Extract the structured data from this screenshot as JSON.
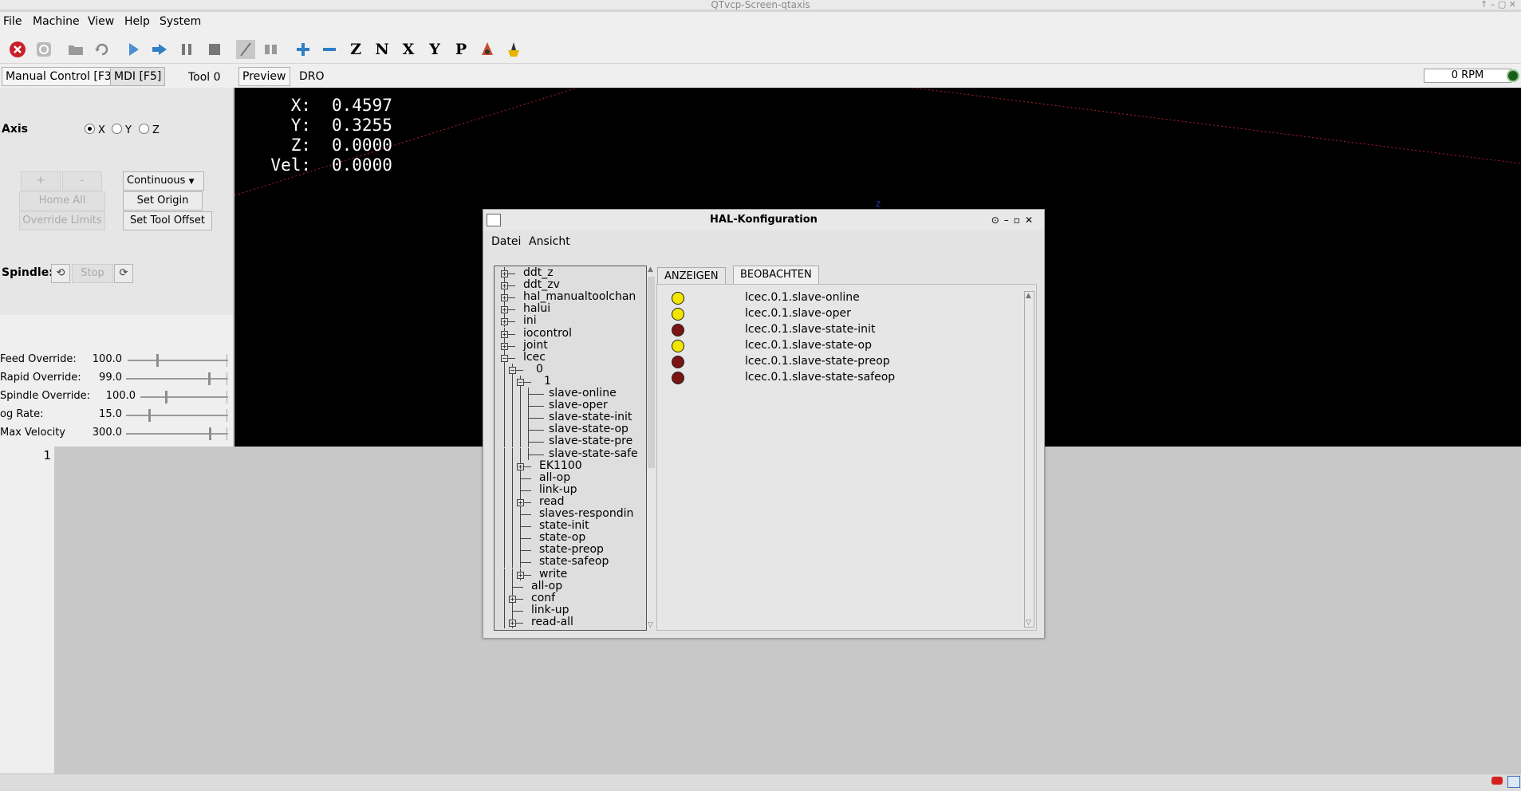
{
  "window_title": "QTvcp-Screen-qtaxis",
  "menu": [
    "File",
    "Machine",
    "View",
    "Help",
    "System"
  ],
  "tabs": {
    "manual": "Manual Control [F3]",
    "mdi": "MDI [F5]",
    "tool": "Tool 0",
    "preview": "Preview",
    "dro": "DRO"
  },
  "rpm": "0 RPM",
  "axis": {
    "label": "Axis",
    "options": [
      "X",
      "Y",
      "Z"
    ],
    "selected": "X"
  },
  "jog": {
    "plus": "+",
    "minus": "-",
    "home_all": "Home All",
    "override_limits": "Override Limits",
    "mode": "Continuous",
    "set_origin": "Set Origin",
    "set_tool_offset": "Set Tool Offset"
  },
  "spindle": {
    "label": "Spindle:",
    "stop": "Stop"
  },
  "overrides": [
    {
      "label": "Feed Override:",
      "value": "100.0",
      "fraction": 0.29
    },
    {
      "label": "Rapid Override:",
      "value": "99.0",
      "fraction": 0.82
    },
    {
      "label": "Spindle Override:",
      "value": "100.0",
      "fraction": 0.29
    },
    {
      "label": "og Rate:",
      "value": "15.0",
      "fraction": 0.22
    },
    {
      "label": "Max Velocity",
      "value": "300.0",
      "fraction": 0.83
    }
  ],
  "dro": [
    {
      "axis": "X:",
      "value": "0.4597"
    },
    {
      "axis": "Y:",
      "value": "0.3255"
    },
    {
      "axis": "Z:",
      "value": "0.0000"
    },
    {
      "axis": "Vel:",
      "value": "0.0000"
    }
  ],
  "editor": {
    "line_no": "1"
  },
  "hal": {
    "title": "HAL-Konfiguration",
    "menu": [
      "Datei",
      "Ansicht"
    ],
    "tabs": [
      "ANZEIGEN",
      "BEOBACHTEN"
    ],
    "tree": [
      {
        "label": "ddt_z",
        "level": 0,
        "exp": true
      },
      {
        "label": "ddt_zv",
        "level": 0,
        "exp": true
      },
      {
        "label": "hal_manualtoolchan",
        "level": 0,
        "exp": true
      },
      {
        "label": "halui",
        "level": 0,
        "exp": true
      },
      {
        "label": "ini",
        "level": 0,
        "exp": true
      },
      {
        "label": "iocontrol",
        "level": 0,
        "exp": true
      },
      {
        "label": "joint",
        "level": 0,
        "exp": true
      },
      {
        "label": "lcec",
        "level": 0,
        "exp": true
      },
      {
        "label": "0",
        "level": 1,
        "exp": true
      },
      {
        "label": "1",
        "level": 2,
        "exp": true
      },
      {
        "label": "slave-online",
        "level": 3,
        "exp": false
      },
      {
        "label": "slave-oper",
        "level": 3,
        "exp": false
      },
      {
        "label": "slave-state-init",
        "level": 3,
        "exp": false
      },
      {
        "label": "slave-state-op",
        "level": 3,
        "exp": false
      },
      {
        "label": "slave-state-pre",
        "level": 3,
        "exp": false
      },
      {
        "label": "slave-state-safe",
        "level": 3,
        "exp": false
      },
      {
        "label": "EK1100",
        "level": 2,
        "exp": true
      },
      {
        "label": "all-op",
        "level": 2,
        "exp": false
      },
      {
        "label": "link-up",
        "level": 2,
        "exp": false
      },
      {
        "label": "read",
        "level": 2,
        "exp": true
      },
      {
        "label": "slaves-respondin",
        "level": 2,
        "exp": false
      },
      {
        "label": "state-init",
        "level": 2,
        "exp": false
      },
      {
        "label": "state-op",
        "level": 2,
        "exp": false
      },
      {
        "label": "state-preop",
        "level": 2,
        "exp": false
      },
      {
        "label": "state-safeop",
        "level": 2,
        "exp": false
      },
      {
        "label": "write",
        "level": 2,
        "exp": true
      },
      {
        "label": "all-op",
        "level": 1,
        "exp": false
      },
      {
        "label": "conf",
        "level": 1,
        "exp": true
      },
      {
        "label": "link-up",
        "level": 1,
        "exp": false
      },
      {
        "label": "read-all",
        "level": 1,
        "exp": true
      }
    ],
    "watch": [
      {
        "name": "lcec.0.1.slave-online",
        "state": "on"
      },
      {
        "name": "lcec.0.1.slave-oper",
        "state": "on"
      },
      {
        "name": "lcec.0.1.slave-state-init",
        "state": "off"
      },
      {
        "name": "lcec.0.1.slave-state-op",
        "state": "on"
      },
      {
        "name": "lcec.0.1.slave-state-preop",
        "state": "off"
      },
      {
        "name": "lcec.0.1.slave-state-safeop",
        "state": "off"
      }
    ],
    "colors": {
      "on": "#f2e600",
      "off": "#7a1414"
    }
  }
}
